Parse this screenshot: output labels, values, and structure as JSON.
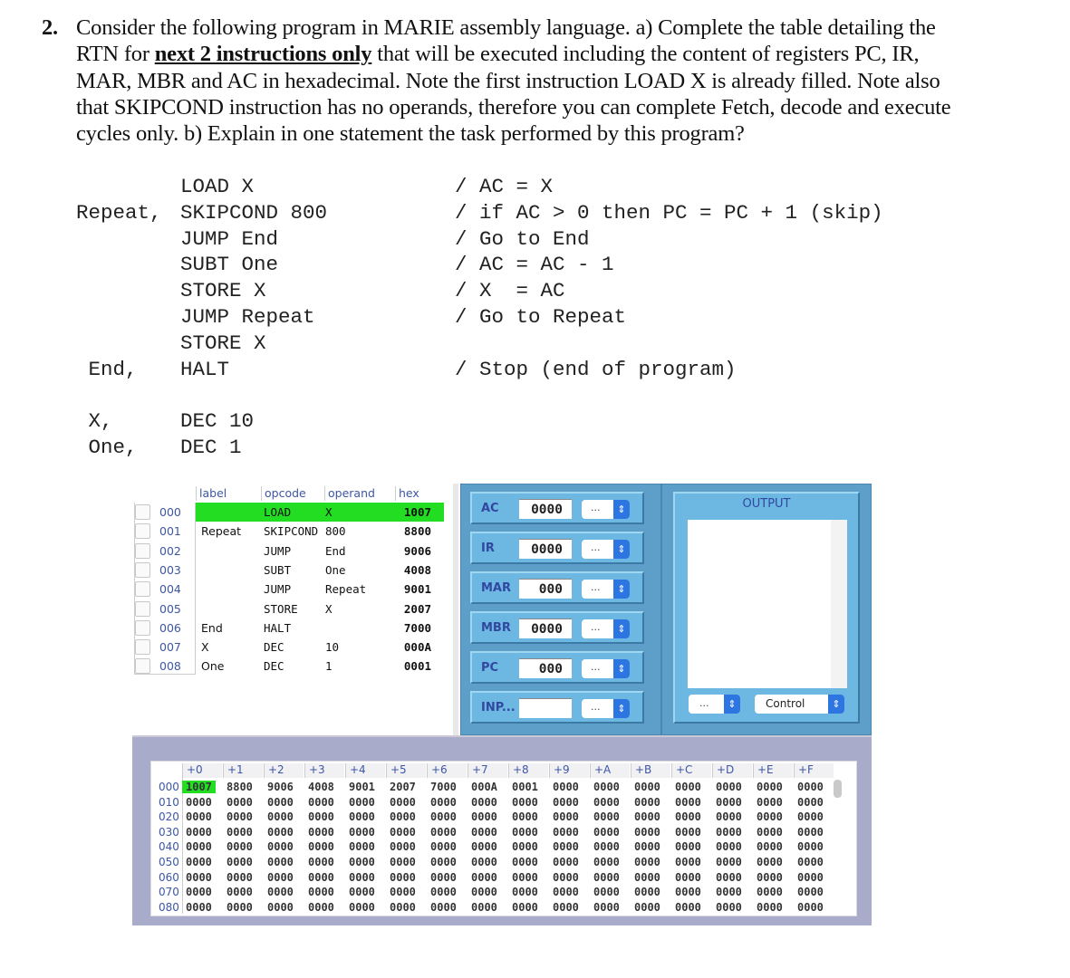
{
  "question": {
    "number": "2.",
    "part1": "Consider the following program in MARIE assembly language. a) Complete the table detailing the RTN for ",
    "emphasis": "next 2 instructions only",
    "part2": " that will be executed including the content of registers PC, IR, MAR, MBR and AC in hexadecimal. Note the first instruction LOAD X is already filled. Note also that SKIPCOND instruction has no operands, therefore you can complete Fetch, decode and execute cycles only. b) Explain in one statement the task performed by this program?"
  },
  "code": [
    {
      "label": "",
      "instr": "LOAD X",
      "comment": "/ AC = X"
    },
    {
      "label": "Repeat,",
      "instr": "SKIPCOND 800",
      "comment": "/ if AC > 0 then PC = PC + 1 (skip)"
    },
    {
      "label": "",
      "instr": "JUMP End",
      "comment": "/ Go to End"
    },
    {
      "label": "",
      "instr": "SUBT One",
      "comment": "/ AC = AC - 1"
    },
    {
      "label": "",
      "instr": "STORE X",
      "comment": "/ X  = AC"
    },
    {
      "label": "",
      "instr": "JUMP Repeat",
      "comment": "/ Go to Repeat"
    },
    {
      "label": "",
      "instr": "STORE X",
      "comment": ""
    },
    {
      "label": " End,",
      "instr": "HALT",
      "comment": "/ Stop (end of program)"
    },
    {
      "label": "",
      "instr": "",
      "comment": ""
    },
    {
      "label": " X,",
      "instr": "DEC 10",
      "comment": ""
    },
    {
      "label": " One,",
      "instr": "DEC 1",
      "comment": ""
    }
  ],
  "simulator": {
    "program": {
      "headers": {
        "label": "label",
        "opcode": "opcode",
        "operand": "operand",
        "hex": "hex"
      },
      "rows": [
        {
          "addr": "000",
          "label": "",
          "opcode": "LOAD",
          "operand": "X",
          "hex": "1007",
          "current": true
        },
        {
          "addr": "001",
          "label": "Repeat",
          "opcode": "SKIPCOND",
          "operand": "800",
          "hex": "8800",
          "current": false
        },
        {
          "addr": "002",
          "label": "",
          "opcode": "JUMP",
          "operand": "End",
          "hex": "9006",
          "current": false
        },
        {
          "addr": "003",
          "label": "",
          "opcode": "SUBT",
          "operand": "One",
          "hex": "4008",
          "current": false
        },
        {
          "addr": "004",
          "label": "",
          "opcode": "JUMP",
          "operand": "Repeat",
          "hex": "9001",
          "current": false
        },
        {
          "addr": "005",
          "label": "",
          "opcode": "STORE",
          "operand": "X",
          "hex": "2007",
          "current": false
        },
        {
          "addr": "006",
          "label": "End",
          "opcode": "HALT",
          "operand": "",
          "hex": "7000",
          "current": false
        },
        {
          "addr": "007",
          "label": "X",
          "opcode": "DEC",
          "operand": "10",
          "hex": "000A",
          "current": false
        },
        {
          "addr": "008",
          "label": "One",
          "opcode": "DEC",
          "operand": "1",
          "hex": "0001",
          "current": false
        }
      ]
    },
    "registers": [
      {
        "name": "AC",
        "value": "0000",
        "format": "..."
      },
      {
        "name": "IR",
        "value": "0000",
        "format": "..."
      },
      {
        "name": "MAR",
        "value": "000",
        "format": "..."
      },
      {
        "name": "MBR",
        "value": "0000",
        "format": "..."
      },
      {
        "name": "PC",
        "value": "000",
        "format": "..."
      },
      {
        "name": "INP...",
        "value": "",
        "format": "..."
      }
    ],
    "output": {
      "title": "OUTPUT",
      "format_select": "...",
      "control_select": "Control"
    },
    "memory": {
      "col_headers": [
        "+0",
        "+1",
        "+2",
        "+3",
        "+4",
        "+5",
        "+6",
        "+7",
        "+8",
        "+9",
        "+A",
        "+B",
        "+C",
        "+D",
        "+E",
        "+F"
      ],
      "rows": [
        {
          "addr": "000",
          "cells": [
            "1007",
            "8800",
            "9006",
            "4008",
            "9001",
            "2007",
            "7000",
            "000A",
            "0001",
            "0000",
            "0000",
            "0000",
            "0000",
            "0000",
            "0000",
            "0000"
          ]
        },
        {
          "addr": "010",
          "cells": [
            "0000",
            "0000",
            "0000",
            "0000",
            "0000",
            "0000",
            "0000",
            "0000",
            "0000",
            "0000",
            "0000",
            "0000",
            "0000",
            "0000",
            "0000",
            "0000"
          ]
        },
        {
          "addr": "020",
          "cells": [
            "0000",
            "0000",
            "0000",
            "0000",
            "0000",
            "0000",
            "0000",
            "0000",
            "0000",
            "0000",
            "0000",
            "0000",
            "0000",
            "0000",
            "0000",
            "0000"
          ]
        },
        {
          "addr": "030",
          "cells": [
            "0000",
            "0000",
            "0000",
            "0000",
            "0000",
            "0000",
            "0000",
            "0000",
            "0000",
            "0000",
            "0000",
            "0000",
            "0000",
            "0000",
            "0000",
            "0000"
          ]
        },
        {
          "addr": "040",
          "cells": [
            "0000",
            "0000",
            "0000",
            "0000",
            "0000",
            "0000",
            "0000",
            "0000",
            "0000",
            "0000",
            "0000",
            "0000",
            "0000",
            "0000",
            "0000",
            "0000"
          ]
        },
        {
          "addr": "050",
          "cells": [
            "0000",
            "0000",
            "0000",
            "0000",
            "0000",
            "0000",
            "0000",
            "0000",
            "0000",
            "0000",
            "0000",
            "0000",
            "0000",
            "0000",
            "0000",
            "0000"
          ]
        },
        {
          "addr": "060",
          "cells": [
            "0000",
            "0000",
            "0000",
            "0000",
            "0000",
            "0000",
            "0000",
            "0000",
            "0000",
            "0000",
            "0000",
            "0000",
            "0000",
            "0000",
            "0000",
            "0000"
          ]
        },
        {
          "addr": "070",
          "cells": [
            "0000",
            "0000",
            "0000",
            "0000",
            "0000",
            "0000",
            "0000",
            "0000",
            "0000",
            "0000",
            "0000",
            "0000",
            "0000",
            "0000",
            "0000",
            "0000"
          ]
        },
        {
          "addr": "080",
          "cells": [
            "0000",
            "0000",
            "0000",
            "0000",
            "0000",
            "0000",
            "0000",
            "0000",
            "0000",
            "0000",
            "0000",
            "0000",
            "0000",
            "0000",
            "0000",
            "0000"
          ]
        }
      ],
      "highlight_cell": "000+0"
    },
    "colors": {
      "highlight_green": "#22dd22",
      "panel_blue": "#5d9fc9",
      "register_blue": "#6db8e2",
      "label_navy": "#3148a0",
      "memory_bg": "#a9abcb",
      "select_arrow": "#2d75e0"
    }
  }
}
